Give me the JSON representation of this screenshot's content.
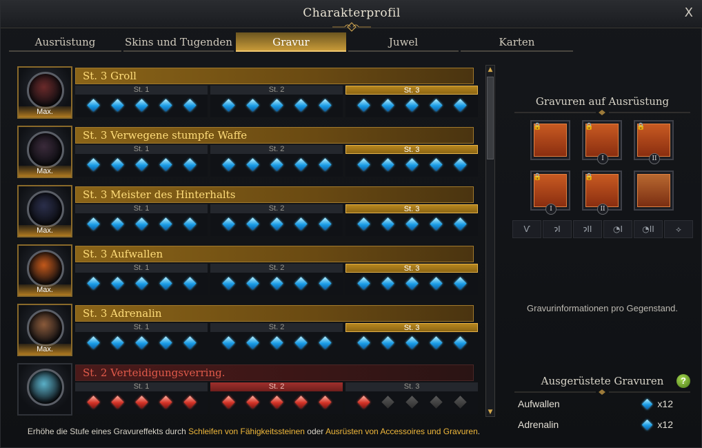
{
  "window": {
    "title": "Charakterprofil",
    "close_label": "X"
  },
  "tabs": [
    {
      "label": "Ausrüstung",
      "active": false
    },
    {
      "label": "Skins und Tugenden",
      "active": false
    },
    {
      "label": "Gravur",
      "active": true
    },
    {
      "label": "Juwel",
      "active": false
    },
    {
      "label": "Karten",
      "active": false
    }
  ],
  "engravings": [
    {
      "name": "St. 3 Groll",
      "max_label": "Max.",
      "orb_color": "#6a2a2a",
      "current_stage": 3,
      "active_gems": 15,
      "kind": "gold"
    },
    {
      "name": "St. 3 Verwegene stumpfe Waffe",
      "max_label": "Max.",
      "orb_color": "#3a2a3a",
      "current_stage": 3,
      "active_gems": 15,
      "kind": "gold"
    },
    {
      "name": "St. 3 Meister des Hinterhalts",
      "max_label": "Max.",
      "orb_color": "#2a2e4a",
      "current_stage": 3,
      "active_gems": 15,
      "kind": "gold"
    },
    {
      "name": "St. 3 Aufwallen",
      "max_label": "Max.",
      "orb_color": "#c2581a",
      "current_stage": 3,
      "active_gems": 15,
      "kind": "gold"
    },
    {
      "name": "St. 3 Adrenalin",
      "max_label": "Max.",
      "orb_color": "#8a5a3a",
      "current_stage": 3,
      "active_gems": 15,
      "kind": "gold"
    },
    {
      "name": "St. 2 Verteidigungsverring.",
      "max_label": "",
      "orb_color": "#5ab0c8",
      "current_stage": 2,
      "active_gems": 11,
      "kind": "red"
    }
  ],
  "stage_labels": [
    "St. 1",
    "St. 2",
    "St. 3"
  ],
  "scrollbar": {
    "up": "▲",
    "down": "▼"
  },
  "footer": {
    "prefix": "Erhöhe die Stufe eines Gravureffekts durch ",
    "link1": "Schleifen von Fähigkeitssteinen",
    "middle": " oder ",
    "link2": "Ausrüsten von Accessoires und Gravuren",
    "suffix": "."
  },
  "side": {
    "equip_title": "Gravuren auf Ausrüstung",
    "items": [
      {
        "name": "necklace-item",
        "lock": "🔒",
        "roman": ""
      },
      {
        "name": "earring-item-1",
        "lock": "🔒",
        "roman": "I"
      },
      {
        "name": "earring-item-2",
        "lock": "🔒",
        "roman": "II"
      },
      {
        "name": "ring-item-1",
        "lock": "🔒",
        "roman": "I"
      },
      {
        "name": "ring-item-2",
        "lock": "🔒",
        "roman": "II"
      },
      {
        "name": "stone-item",
        "lock": "",
        "roman": ""
      }
    ],
    "slot_icons": [
      "necklace-icon",
      "earring-1-icon",
      "earring-2-icon",
      "ring-1-icon",
      "ring-2-icon",
      "stone-icon"
    ],
    "slot_glyphs": [
      "Ѵ",
      "ɂI",
      "ɂII",
      "◔I",
      "◔II",
      "⟡"
    ],
    "info_text": "Gravurinformationen pro Gegenstand.",
    "equipped_title": "Ausgerüstete Gravuren",
    "help_label": "?",
    "equipped": [
      {
        "name": "Aufwallen",
        "count": "x12"
      },
      {
        "name": "Adrenalin",
        "count": "x12"
      }
    ]
  }
}
